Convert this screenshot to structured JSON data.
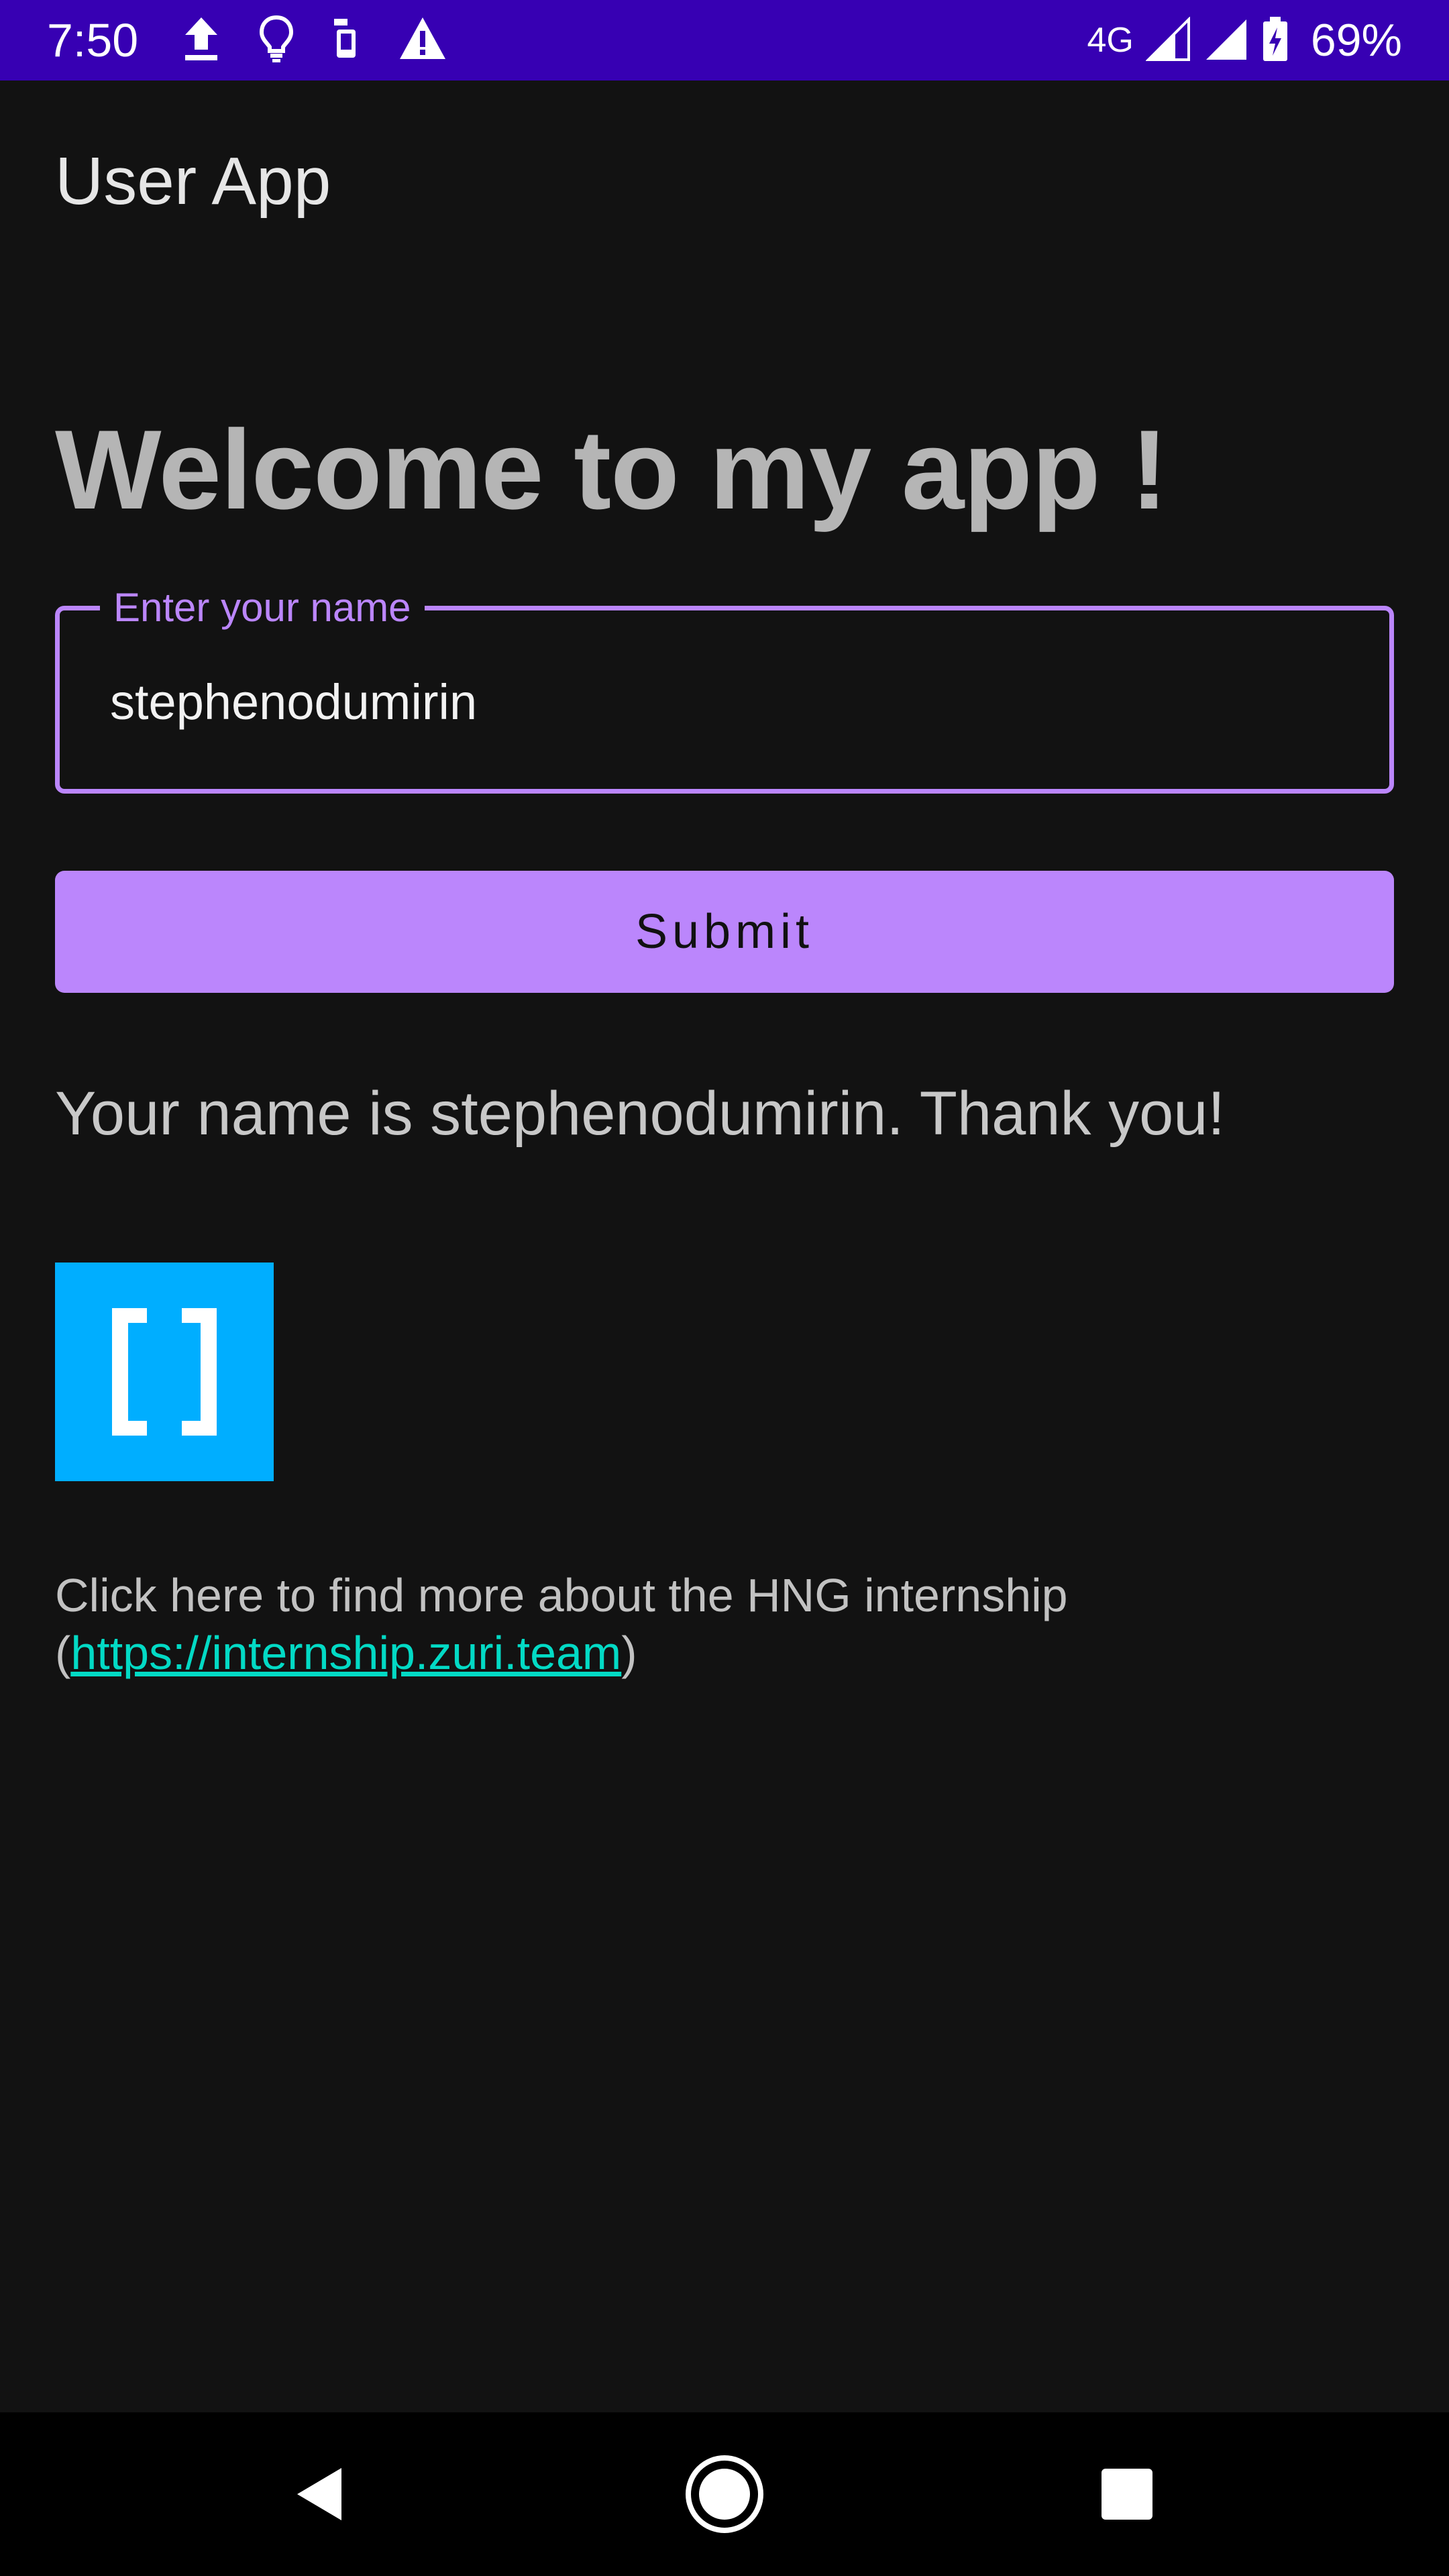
{
  "status_bar": {
    "time": "7:50",
    "network": "4G",
    "battery": "69%",
    "left_icons": [
      "upload-icon",
      "lightbulb-icon",
      "phone-transfer-icon",
      "warning-icon"
    ],
    "right_icons": [
      "signal-icon",
      "signal-icon",
      "battery-charging-icon"
    ]
  },
  "app_bar": {
    "title": "User App"
  },
  "main": {
    "welcome": "Welcome to my app !",
    "name_field": {
      "label": "Enter your name",
      "value": "stephenodumirin"
    },
    "submit_label": "Submit",
    "result": "Your name is stephenodumirin. Thank you!",
    "logo_icon": "brackets-logo",
    "info": {
      "prefix": "Click here to find more about the HNG internship",
      "open_paren": "(",
      "link": "https://internship.zuri.team",
      "close_paren": ")"
    }
  },
  "nav_bar": {
    "icons": [
      "back-icon",
      "home-icon",
      "recents-icon"
    ]
  },
  "colors": {
    "status_bar": "#3700b3",
    "background": "#121212",
    "accent": "#bb86fc",
    "link": "#03dac5",
    "logo": "#00aeff"
  }
}
